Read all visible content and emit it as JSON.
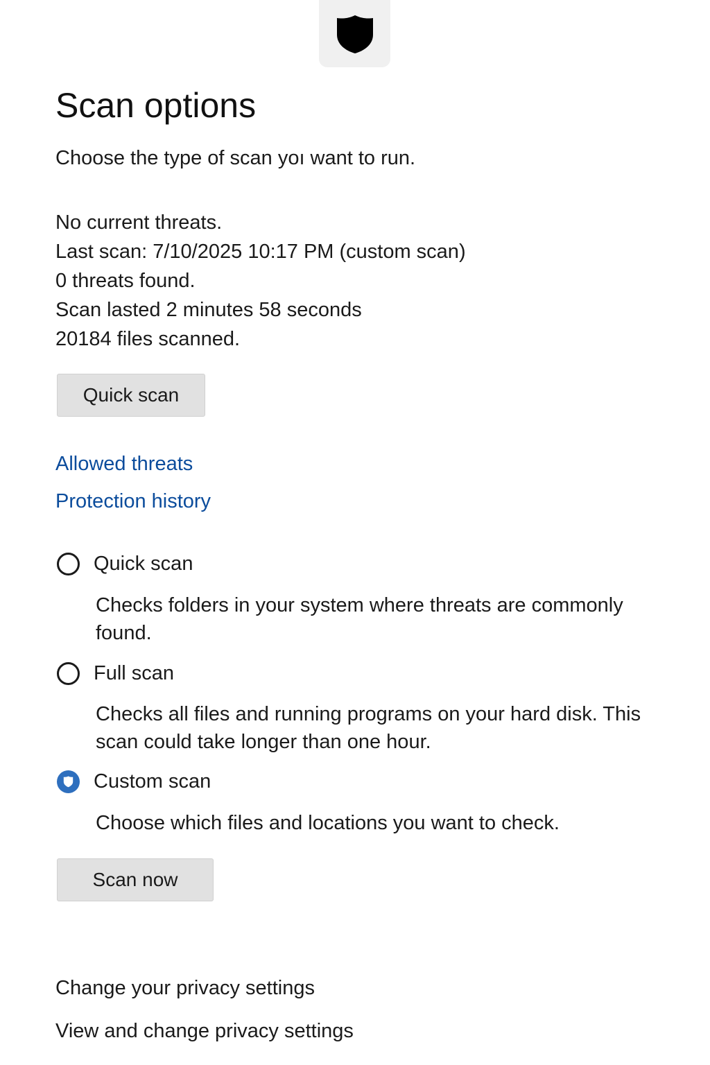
{
  "header": {
    "icon": "shield-icon",
    "title": "Scan options",
    "subtitle": "Choose the type of scan yoı want to run."
  },
  "status": {
    "threats": "No current threats.",
    "last_scan": "Last scan: 7/10/2025  10:17 PM (custom scan)",
    "threats_found": "0 threats found.",
    "duration": "Scan lasted 2 minutes 58 seconds",
    "files_scanned": "20184 files scanned."
  },
  "actions": {
    "quick_scan_button": "Quick scan",
    "scan_now_button": "Scan now"
  },
  "links": {
    "allowed_threats": "Allowed threats",
    "protection_history": "Protection history"
  },
  "scan_options": [
    {
      "label": "Quick scan",
      "description": "Checks folders in your system where threats are commonly found.",
      "selected": false
    },
    {
      "label": "Full scan",
      "description": "Checks all files and running programs on your hard disk. This scan could take longer than one hour.",
      "selected": false
    },
    {
      "label": "Custom scan",
      "description": "Choose which files and locations you want to check.",
      "selected": true
    }
  ],
  "privacy": {
    "heading": "Change your privacy settings",
    "link": "View and change privacy settings"
  },
  "colors": {
    "link": "#0b4c9c",
    "radio_selected": "#2e6fbe",
    "button_bg": "#e1e1e1"
  }
}
